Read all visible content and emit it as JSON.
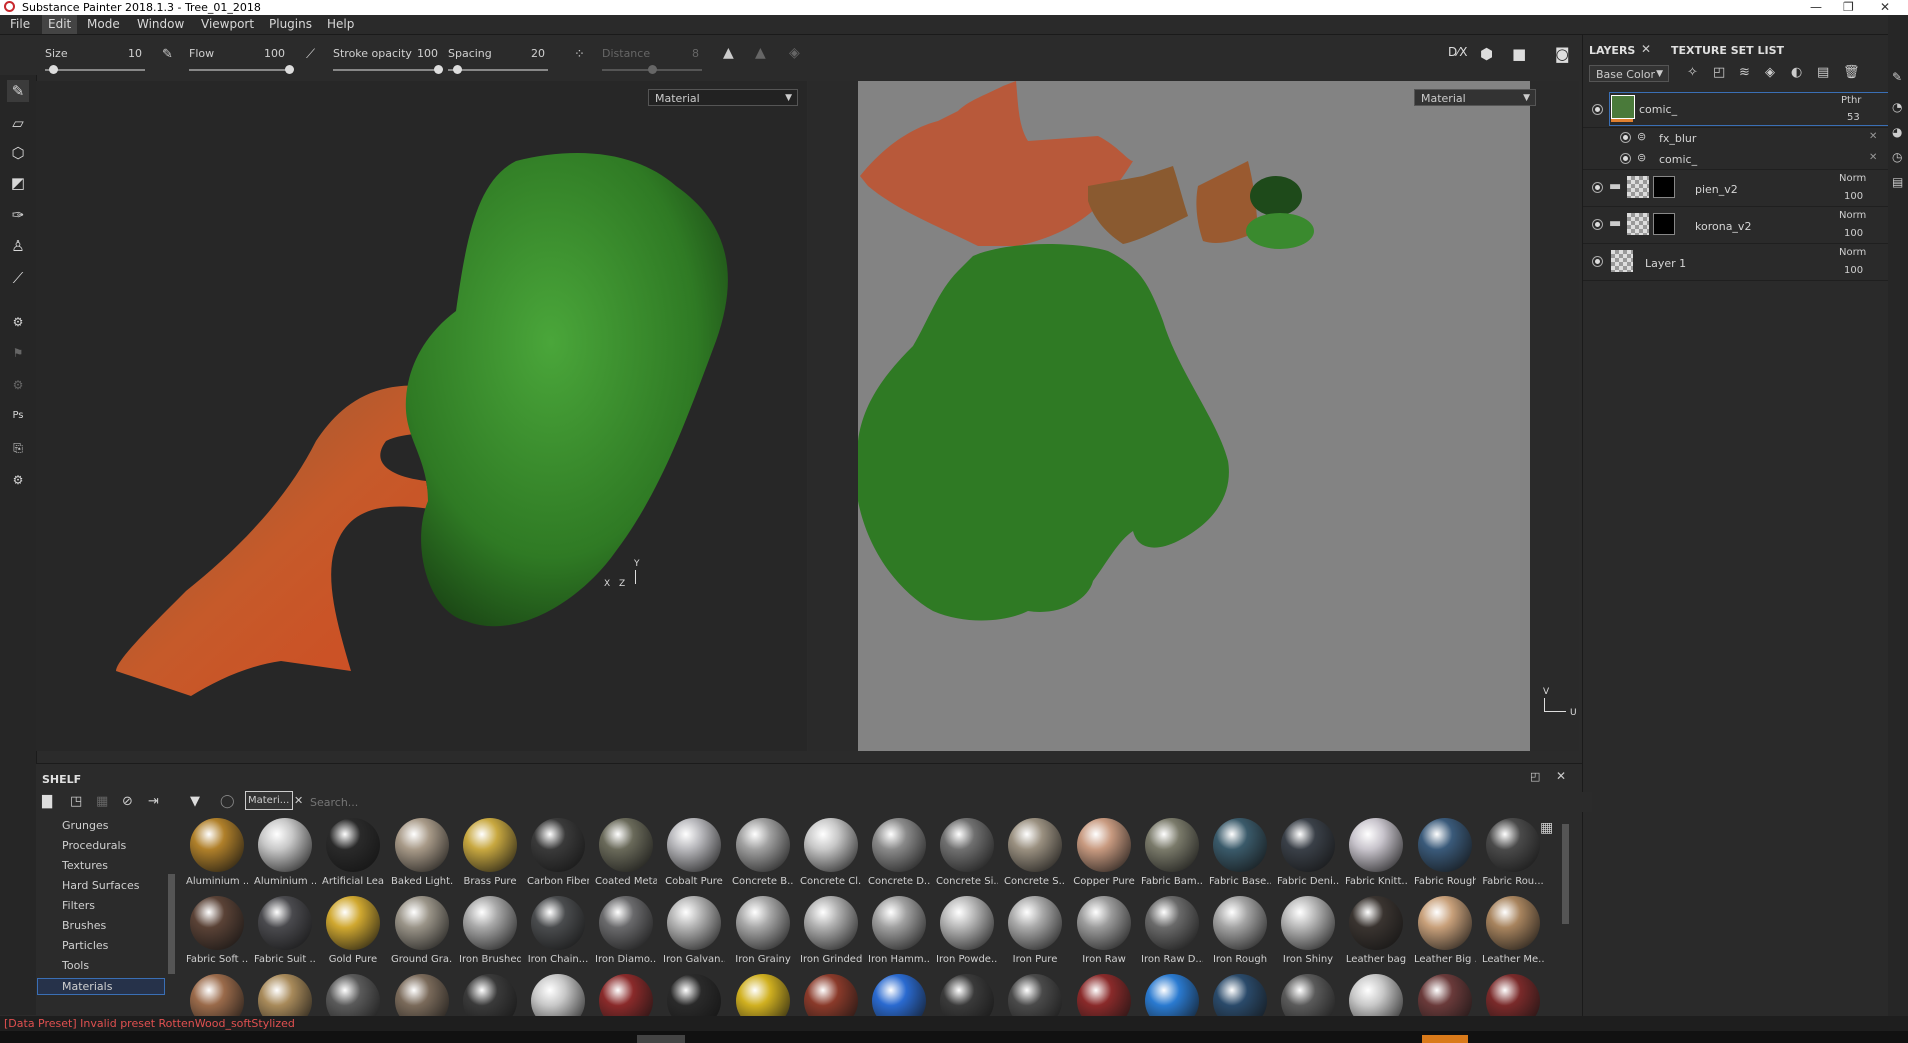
{
  "window": {
    "title": "Substance Painter 2018.1.3 - Tree_01_2018",
    "controls": [
      "—",
      "❐",
      "✕"
    ]
  },
  "menu": [
    "File",
    "Edit",
    "Mode",
    "Window",
    "Viewport",
    "Plugins",
    "Help"
  ],
  "menu_active": "Edit",
  "tool_options": {
    "size": {
      "label": "Size",
      "value": "10",
      "level": 0.08
    },
    "flow": {
      "label": "Flow",
      "value": "100",
      "level": 1.0
    },
    "stroke_opacity": {
      "label": "Stroke opacity",
      "value": "100",
      "level": 1.0
    },
    "spacing": {
      "label": "Spacing",
      "value": "20",
      "level": 0.05
    },
    "distance": {
      "label": "Distance",
      "value": "8",
      "level": 0.5
    }
  },
  "viewport3d": {
    "mode": "Material",
    "axis_y": "Y",
    "axis_x": "X",
    "axis_z": "Z"
  },
  "viewport2d": {
    "mode": "Material",
    "axis_v": "V",
    "axis_u": "U"
  },
  "layers_panel": {
    "tabs": [
      "LAYERS",
      "TEXTURE SET LIST"
    ],
    "channel": "Base Color",
    "layers": [
      {
        "name": "comic_",
        "blend": "Pthr",
        "opacity": "53",
        "selected": true
      },
      {
        "name": "fx_blur",
        "effect": true
      },
      {
        "name": "comic_",
        "effect": true
      },
      {
        "name": "pien_v2",
        "blend": "Norm",
        "opacity": "100",
        "folder": true
      },
      {
        "name": "korona_v2",
        "blend": "Norm",
        "opacity": "100",
        "folder": true
      },
      {
        "name": "Layer 1",
        "blend": "Norm",
        "opacity": "100"
      }
    ]
  },
  "shelf": {
    "title": "SHELF",
    "filter_tag": "Materi...",
    "search_placeholder": "Search...",
    "categories": [
      "Grunges",
      "Procedurals",
      "Textures",
      "Hard Surfaces",
      "Filters",
      "Brushes",
      "Particles",
      "Tools",
      "Materials"
    ],
    "selected_category": "Materials",
    "materials_row1": [
      {
        "label": "Aluminium ...",
        "color": "#b0802a"
      },
      {
        "label": "Aluminium ...",
        "color": "#c8c8c8"
      },
      {
        "label": "Artificial Lea...",
        "color": "#2a2a2a"
      },
      {
        "label": "Baked Light...",
        "color": "#a89a88"
      },
      {
        "label": "Brass Pure",
        "color": "#c8a840"
      },
      {
        "label": "Carbon Fiber",
        "color": "#3a3a3a"
      },
      {
        "label": "Coated Metal",
        "color": "#6a6a5a"
      },
      {
        "label": "Cobalt Pure",
        "color": "#b8b8bc"
      },
      {
        "label": "Concrete B...",
        "color": "#a0a0a0"
      },
      {
        "label": "Concrete Cl...",
        "color": "#c8c8c8"
      },
      {
        "label": "Concrete D...",
        "color": "#8a8a8a"
      },
      {
        "label": "Concrete Si...",
        "color": "#707070"
      },
      {
        "label": "Concrete S...",
        "color": "#9a9080"
      },
      {
        "label": "Copper Pure",
        "color": "#c89a80"
      },
      {
        "label": "Fabric Bam...",
        "color": "#7a7a6a"
      },
      {
        "label": "Fabric Base...",
        "color": "#3a5a6a"
      },
      {
        "label": "Fabric Deni...",
        "color": "#3a4048"
      },
      {
        "label": "Fabric Knitt...",
        "color": "#c8c4cc"
      },
      {
        "label": "Fabric Rough",
        "color": "#3a5a7a"
      },
      {
        "label": "Fabric Rou...",
        "color": "#4a4a4a"
      }
    ],
    "materials_row2": [
      {
        "label": "Fabric Soft ...",
        "color": "#5a4236"
      },
      {
        "label": "Fabric Suit ...",
        "color": "#4a4a4e"
      },
      {
        "label": "Gold Pure",
        "color": "#d0a830"
      },
      {
        "label": "Ground Gra...",
        "color": "#9a9488"
      },
      {
        "label": "Iron Brushed",
        "color": "#a8a8a8"
      },
      {
        "label": "Iron Chain...",
        "color": "#4a4c4e"
      },
      {
        "label": "Iron Diamo...",
        "color": "#6a6a6c"
      },
      {
        "label": "Iron Galvan...",
        "color": "#b4b4b4"
      },
      {
        "label": "Iron Grainy",
        "color": "#a8a8a8"
      },
      {
        "label": "Iron Grinded",
        "color": "#b0b0b0"
      },
      {
        "label": "Iron Hamm...",
        "color": "#a0a0a0"
      },
      {
        "label": "Iron Powde...",
        "color": "#b8b8b8"
      },
      {
        "label": "Iron Pure",
        "color": "#aaaaaa"
      },
      {
        "label": "Iron Raw",
        "color": "#9c9c9c"
      },
      {
        "label": "Iron Raw D...",
        "color": "#6a6a6a"
      },
      {
        "label": "Iron Rough",
        "color": "#a4a4a4"
      },
      {
        "label": "Iron Shiny",
        "color": "#b8b8b8"
      },
      {
        "label": "Leather bag",
        "color": "#3a3430"
      },
      {
        "label": "Leather Big ...",
        "color": "#c8a07a"
      },
      {
        "label": "Leather Me...",
        "color": "#a8845e"
      }
    ],
    "materials_row3_colors": [
      "#9a6a4a",
      "#a88a5a",
      "#5a5a5a",
      "#7a6a5a",
      "#3a3a3a",
      "#c8c8c8",
      "#8a2a2a",
      "#2a2a2a",
      "#d0b020",
      "#8a3a2a",
      "#2a6ad0",
      "#3a3a3a",
      "#4a4a4a",
      "#8a2a2a",
      "#2a7ad0",
      "#2a4a6a",
      "#5a5a5a",
      "#c8c8c8",
      "#6a3a3a",
      "#7a2a2a"
    ]
  },
  "status": {
    "message": "[Data Preset] Invalid preset RottenWood_softStylized"
  }
}
